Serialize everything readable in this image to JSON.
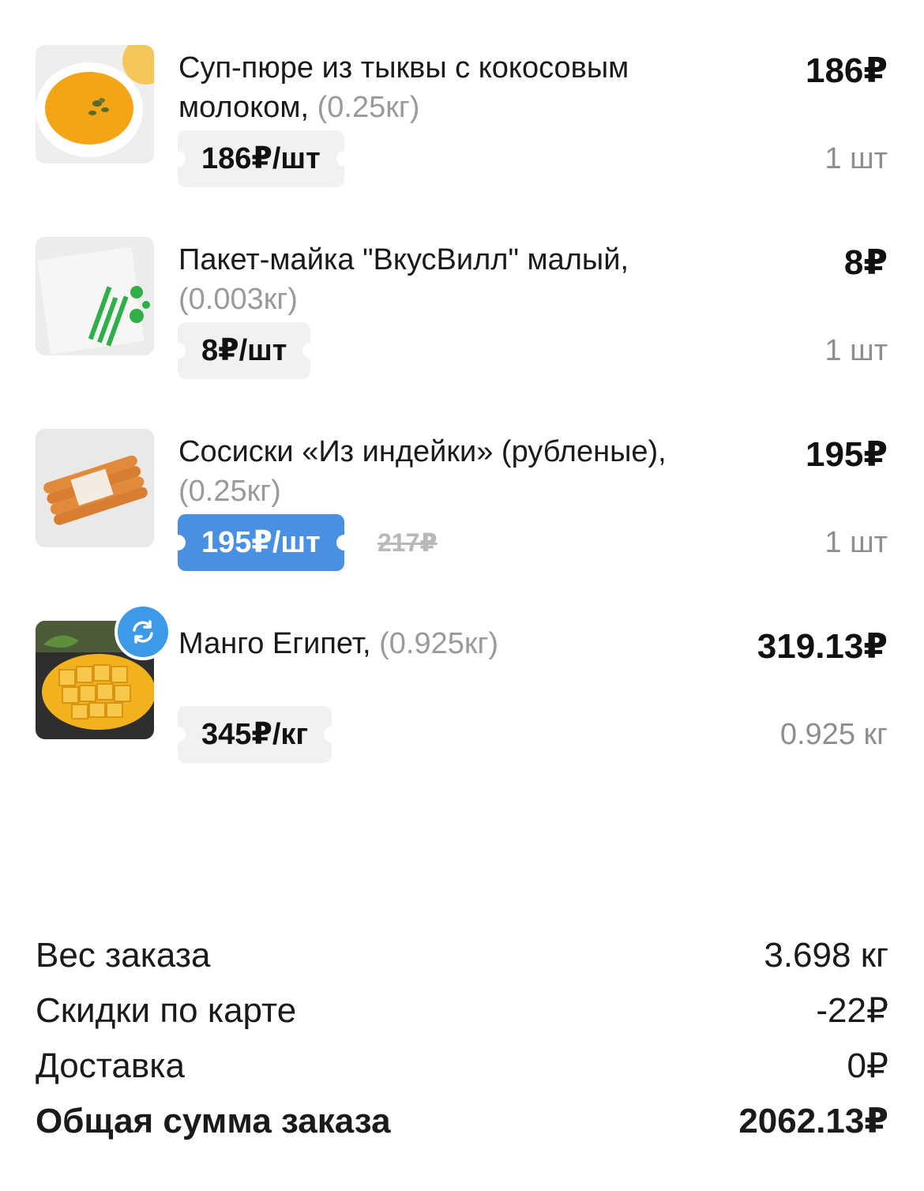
{
  "items": [
    {
      "name": "Суп-пюре из тыквы с кокосовым молоком,",
      "weight": "(0.25кг)",
      "total": "186₽",
      "unit_price": "186₽/шт",
      "qty": "1 шт",
      "image": "pumpkin-soup-image"
    },
    {
      "name": "Пакет-майка \"ВкусВилл\" малый,",
      "weight": "(0.003кг)",
      "total": "8₽",
      "unit_price": "8₽/шт",
      "qty": "1 шт",
      "image": "shopping-bag-image"
    },
    {
      "name": "Сосиски «Из индейки» (рубленые),",
      "weight": "(0.25кг)",
      "total": "195₽",
      "unit_price": "195₽/шт",
      "old_price": "217₽",
      "qty": "1 шт",
      "image": "turkey-sausages-image"
    },
    {
      "name": "Манго Египет,",
      "weight": "(0.925кг)",
      "total": "319.13₽",
      "unit_price": "345₽/кг",
      "qty": "0.925 кг",
      "image": "mango-image",
      "badge_icon": "replace-icon"
    }
  ],
  "summary": {
    "weight_label": "Вес заказа",
    "weight_value": "3.698 кг",
    "discount_label": "Скидки по карте",
    "discount_value": "-22₽",
    "delivery_label": "Доставка",
    "delivery_value": "0₽",
    "total_label": "Общая сумма заказа",
    "total_value": "2062.13₽"
  },
  "colors": {
    "promo_chip": "#4a90e2",
    "swap_badge": "#3d9ae8",
    "chip_bg": "#f1f1f1"
  }
}
